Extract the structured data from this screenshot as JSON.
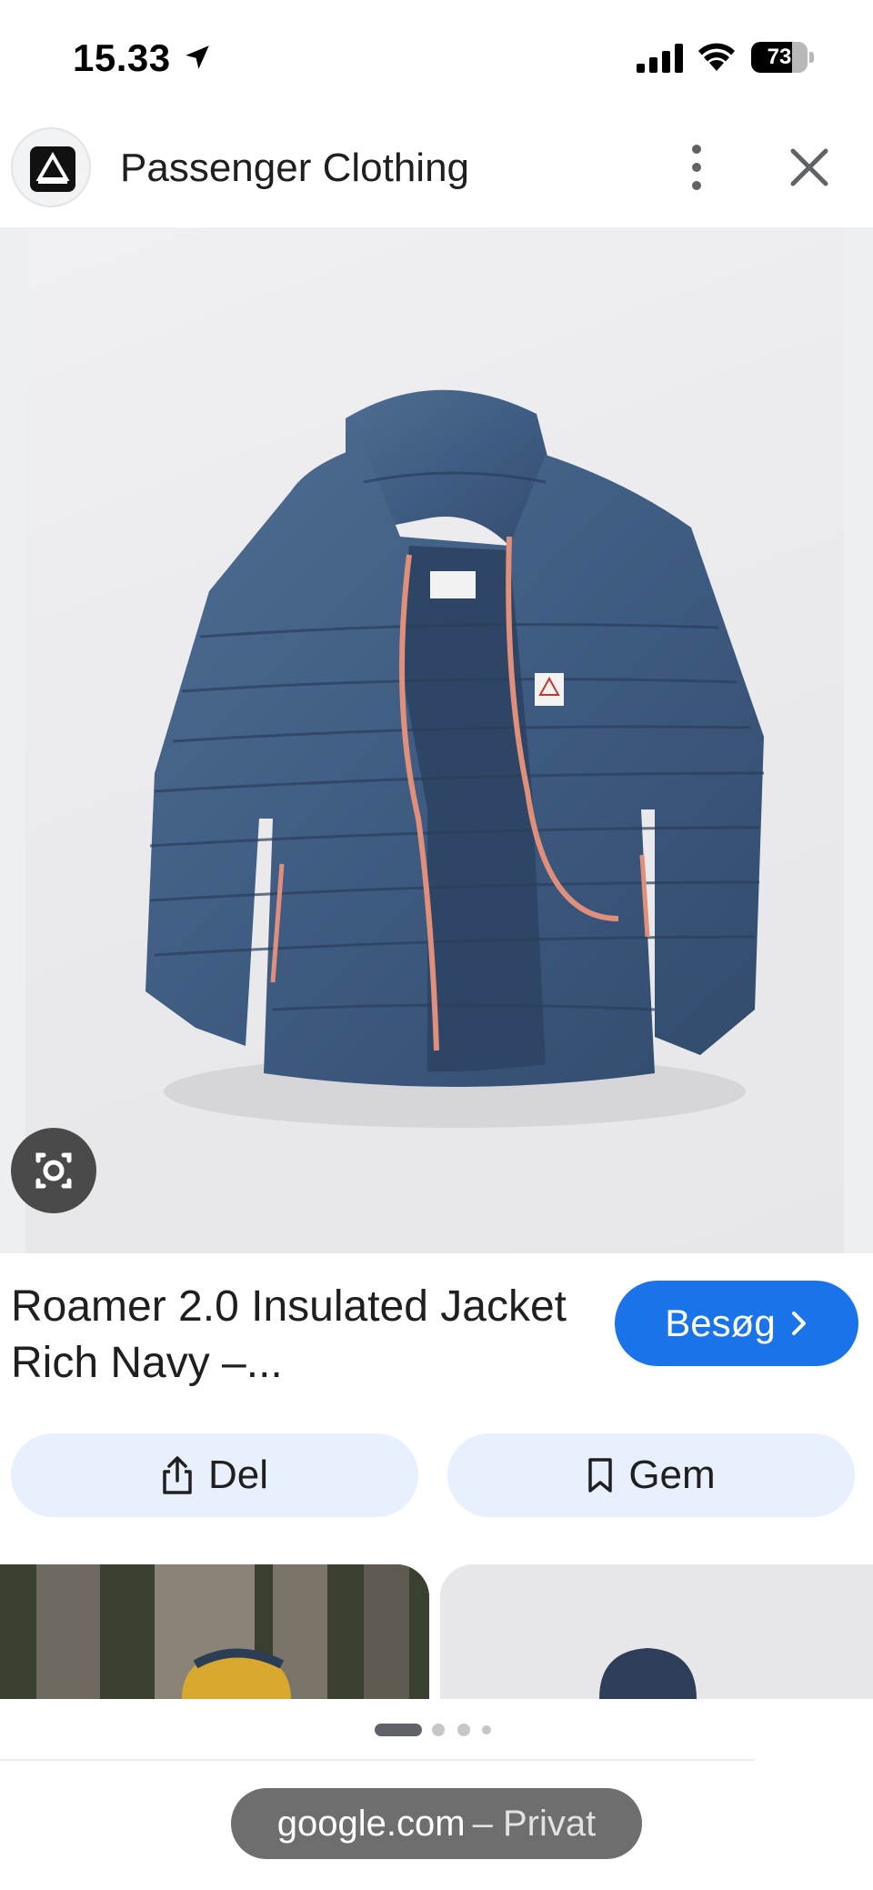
{
  "status_bar": {
    "time": "15.33",
    "battery": "73",
    "battery_level_percent": 73
  },
  "header": {
    "site_name": "Passenger Clothing",
    "icons": [
      "passenger-logo",
      "more-vert-icon",
      "close-icon"
    ]
  },
  "image": {
    "description_icon": "google-lens-icon"
  },
  "product": {
    "title": "Roamer 2.0 Insulated Jacket Rich Navy –...",
    "visit_label": "Besøg",
    "share_label": "Del",
    "save_label": "Gem"
  },
  "pager": {
    "pages": 4,
    "active": 0
  },
  "url_bar": {
    "domain": "google.com",
    "suffix": "– Privat"
  },
  "colors": {
    "accent": "#1a73e8",
    "chip_bg": "#e8f0fe",
    "jacket": "#3d5a80",
    "zipper": "#e0907a"
  }
}
